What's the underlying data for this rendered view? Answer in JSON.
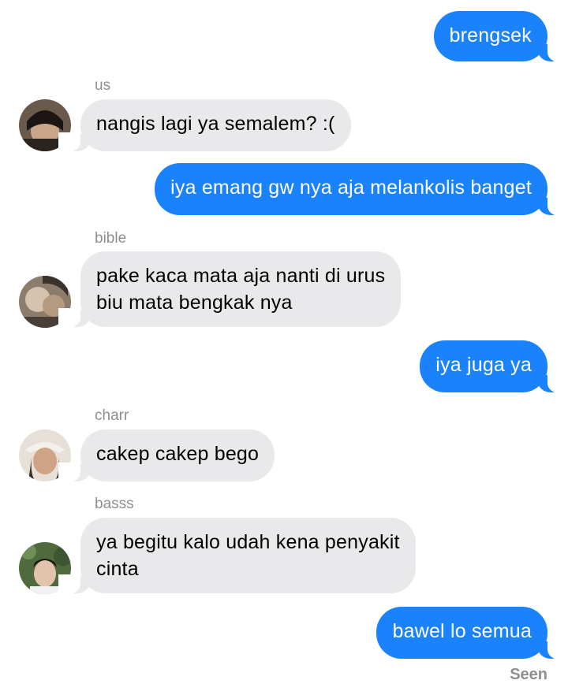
{
  "messages": [
    {
      "sender": "",
      "text": "brengsek",
      "direction": "out"
    },
    {
      "sender": "us",
      "text": "nangis lagi ya semalem? :(",
      "direction": "in",
      "avatar": "avatar-us"
    },
    {
      "sender": "",
      "text": "iya emang gw nya aja melankolis banget",
      "direction": "out"
    },
    {
      "sender": "bible",
      "text": "pake kaca mata aja nanti di urus\nbiu mata bengkak nya",
      "direction": "in",
      "avatar": "avatar-bible"
    },
    {
      "sender": "",
      "text": "iya juga ya",
      "direction": "out"
    },
    {
      "sender": "charr",
      "text": "cakep cakep bego",
      "direction": "in",
      "avatar": "avatar-charr"
    },
    {
      "sender": "basss",
      "text": "ya begitu kalo udah kena penyakit\ncinta",
      "direction": "in",
      "avatar": "avatar-basss"
    },
    {
      "sender": "",
      "text": "bawel lo semua",
      "direction": "out"
    }
  ],
  "status": {
    "seen_label": "Seen"
  },
  "colors": {
    "outgoing_bubble": "#1a82fb",
    "incoming_bubble": "#e9e9eb",
    "sender_name": "#8e8e93"
  }
}
